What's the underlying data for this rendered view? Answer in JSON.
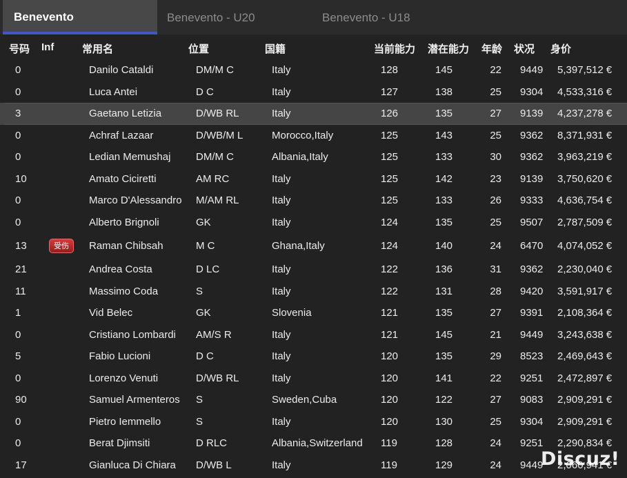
{
  "tabs": [
    {
      "label": "Benevento",
      "active": true
    },
    {
      "label": "Benevento - U20",
      "active": false
    },
    {
      "label": "Benevento - U18",
      "active": false
    }
  ],
  "columns": {
    "number": "号码",
    "inf": "Inf",
    "name": "常用名",
    "position": "位置",
    "nationality": "国籍",
    "current_ability": "当前能力",
    "potential_ability": "潜在能力",
    "age": "年龄",
    "condition": "状况",
    "value": "身价"
  },
  "players": [
    {
      "number": "0",
      "inf": "",
      "name": "Danilo Cataldi",
      "position": "DM/M C",
      "nationality": "Italy",
      "ca": "128",
      "pa": "145",
      "age": "22",
      "condition": "9449",
      "value": "5,397,512 €"
    },
    {
      "number": "0",
      "inf": "",
      "name": "Luca Antei",
      "position": "D C",
      "nationality": "Italy",
      "ca": "127",
      "pa": "138",
      "age": "25",
      "condition": "9304",
      "value": "4,533,316 €"
    },
    {
      "number": "3",
      "inf": "",
      "name": "Gaetano Letizia",
      "position": "D/WB RL",
      "nationality": "Italy",
      "ca": "126",
      "pa": "135",
      "age": "27",
      "condition": "9139",
      "value": "4,237,278 €",
      "selected": true
    },
    {
      "number": "0",
      "inf": "",
      "name": "Achraf Lazaar",
      "position": "D/WB/M L",
      "nationality": "Morocco,Italy",
      "ca": "125",
      "pa": "143",
      "age": "25",
      "condition": "9362",
      "value": "8,371,931 €"
    },
    {
      "number": "0",
      "inf": "",
      "name": "Ledian Memushaj",
      "position": "DM/M C",
      "nationality": "Albania,Italy",
      "ca": "125",
      "pa": "133",
      "age": "30",
      "condition": "9362",
      "value": "3,963,219 €"
    },
    {
      "number": "10",
      "inf": "",
      "name": "Amato Ciciretti",
      "position": "AM RC",
      "nationality": "Italy",
      "ca": "125",
      "pa": "142",
      "age": "23",
      "condition": "9139",
      "value": "3,750,620 €"
    },
    {
      "number": "0",
      "inf": "",
      "name": "Marco D'Alessandro",
      "position": "M/AM RL",
      "nationality": "Italy",
      "ca": "125",
      "pa": "133",
      "age": "26",
      "condition": "9333",
      "value": "4,636,754 €"
    },
    {
      "number": "0",
      "inf": "",
      "name": "Alberto Brignoli",
      "position": "GK",
      "nationality": "Italy",
      "ca": "124",
      "pa": "135",
      "age": "25",
      "condition": "9507",
      "value": "2,787,509 €"
    },
    {
      "number": "13",
      "inf": "受伤",
      "name": "Raman Chibsah",
      "position": "M C",
      "nationality": "Ghana,Italy",
      "ca": "124",
      "pa": "140",
      "age": "24",
      "condition": "6470",
      "value": "4,074,052 €"
    },
    {
      "number": "21",
      "inf": "",
      "name": "Andrea Costa",
      "position": "D LC",
      "nationality": "Italy",
      "ca": "122",
      "pa": "136",
      "age": "31",
      "condition": "9362",
      "value": "2,230,040 €"
    },
    {
      "number": "11",
      "inf": "",
      "name": "Massimo Coda",
      "position": "S",
      "nationality": "Italy",
      "ca": "122",
      "pa": "131",
      "age": "28",
      "condition": "9420",
      "value": "3,591,917 €"
    },
    {
      "number": "1",
      "inf": "",
      "name": "Vid Belec",
      "position": "GK",
      "nationality": "Slovenia",
      "ca": "121",
      "pa": "135",
      "age": "27",
      "condition": "9391",
      "value": "2,108,364 €"
    },
    {
      "number": "0",
      "inf": "",
      "name": "Cristiano Lombardi",
      "position": "AM/S R",
      "nationality": "Italy",
      "ca": "121",
      "pa": "145",
      "age": "21",
      "condition": "9449",
      "value": "3,243,638 €"
    },
    {
      "number": "5",
      "inf": "",
      "name": "Fabio Lucioni",
      "position": "D C",
      "nationality": "Italy",
      "ca": "120",
      "pa": "135",
      "age": "29",
      "condition": "8523",
      "value": "2,469,643 €"
    },
    {
      "number": "0",
      "inf": "",
      "name": "Lorenzo Venuti",
      "position": "D/WB RL",
      "nationality": "Italy",
      "ca": "120",
      "pa": "141",
      "age": "22",
      "condition": "9251",
      "value": "2,472,897 €"
    },
    {
      "number": "90",
      "inf": "",
      "name": "Samuel Armenteros",
      "position": "S",
      "nationality": "Sweden,Cuba",
      "ca": "120",
      "pa": "122",
      "age": "27",
      "condition": "9083",
      "value": "2,909,291 €"
    },
    {
      "number": "0",
      "inf": "",
      "name": "Pietro Iemmello",
      "position": "S",
      "nationality": "Italy",
      "ca": "120",
      "pa": "130",
      "age": "25",
      "condition": "9304",
      "value": "2,909,291 €"
    },
    {
      "number": "0",
      "inf": "",
      "name": "Berat Djimsiti",
      "position": "D RLC",
      "nationality": "Albania,Switzerland",
      "ca": "119",
      "pa": "128",
      "age": "24",
      "condition": "9251",
      "value": "2,290,834 €"
    },
    {
      "number": "17",
      "inf": "",
      "name": "Gianluca Di Chiara",
      "position": "D/WB L",
      "nationality": "Italy",
      "ca": "119",
      "pa": "129",
      "age": "24",
      "condition": "9449",
      "value": "2,060,941 €"
    }
  ],
  "watermark": "Discuz!",
  "colors": {
    "tab_accent": "#4356c4",
    "injury_badge": "#b52727",
    "background": "#222222"
  }
}
